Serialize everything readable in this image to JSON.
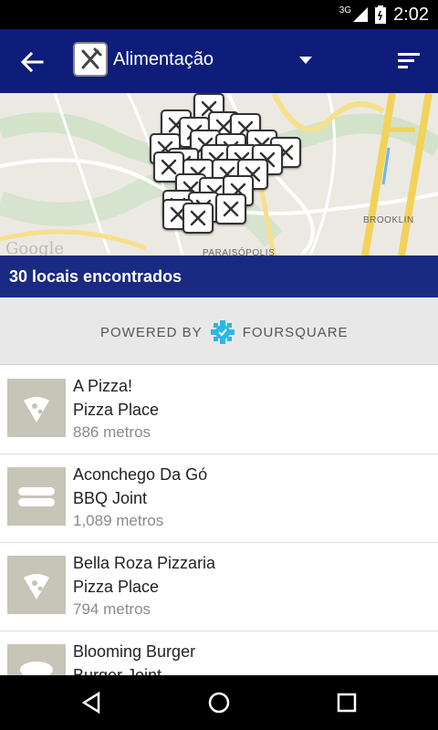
{
  "status_bar": {
    "network": "3G",
    "time": "2:02"
  },
  "app_bar": {
    "title": "Alimentação",
    "icons": {
      "back": "arrow-left-icon",
      "category": "fork-knife-icon",
      "dropdown": "caret-down-icon",
      "sort": "sort-icon"
    }
  },
  "map": {
    "labels": {
      "brooklin": "BROOKLIN",
      "paraisopolis": "PARAISÓPOLIS",
      "google": "Google"
    },
    "pin_icon": "fork-knife-icon"
  },
  "results": {
    "text": "30 locais encontrados"
  },
  "powered": {
    "prefix": "POWERED BY",
    "brand": "FOURSQUARE"
  },
  "places": [
    {
      "name": "A Pizza!",
      "category": "Pizza Place",
      "distance": "886 metros",
      "icon": "pizza-icon"
    },
    {
      "name": "Aconchego Da Gó",
      "category": "BBQ Joint",
      "distance": "1,089 metros",
      "icon": "sausage-icon"
    },
    {
      "name": "Bella Roza Pizzaria",
      "category": "Pizza Place",
      "distance": "794 metros",
      "icon": "pizza-icon"
    },
    {
      "name": "Blooming Burger",
      "category": "Burger Joint",
      "distance": "",
      "icon": "burger-icon"
    }
  ],
  "colors": {
    "app_bar": "#0e1d7a",
    "banner": "#1a2a83",
    "foursquare": "#2ab7e6",
    "thumb": "#c7c4b8"
  }
}
